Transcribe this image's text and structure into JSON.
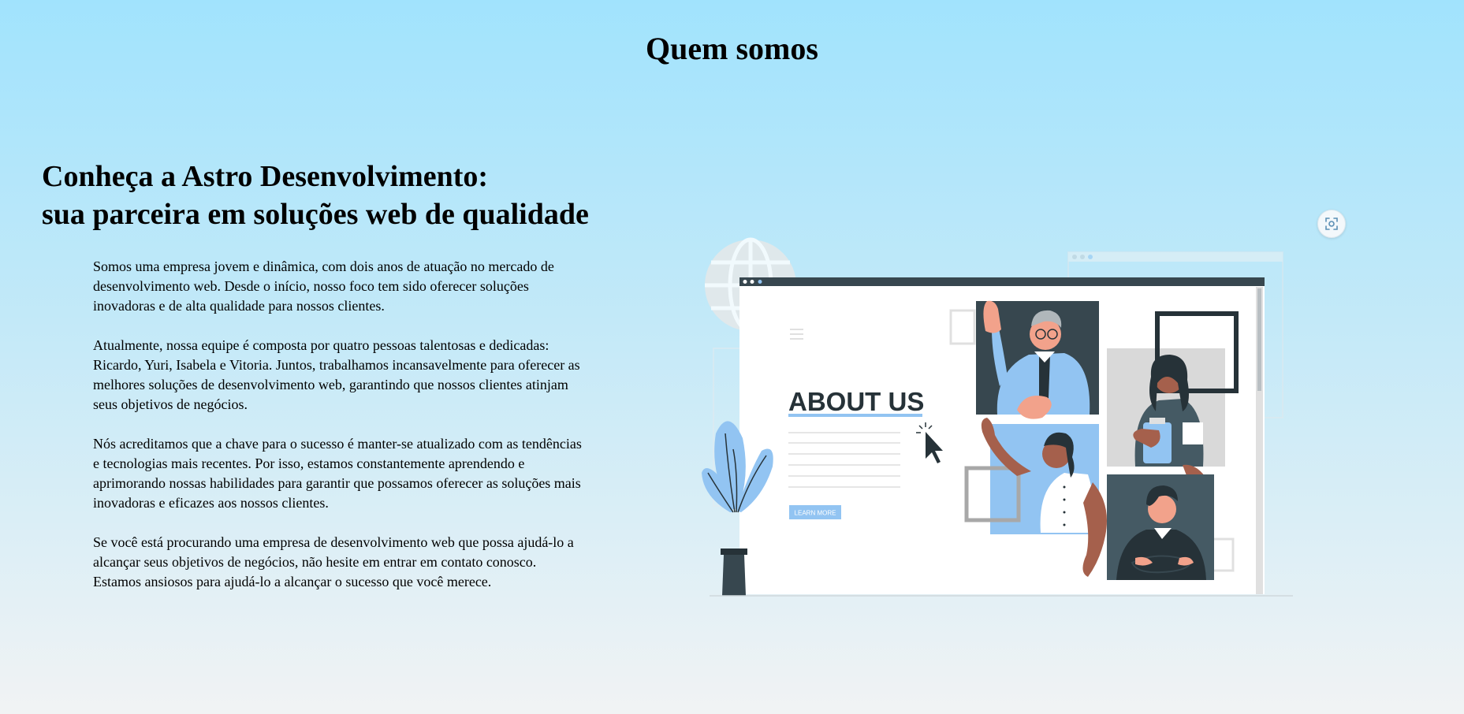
{
  "page": {
    "title": "Quem somos"
  },
  "about": {
    "heading_line1": "Conheça a Astro Desenvolvimento:",
    "heading_line2": "sua parceira em soluções web de qualidade",
    "paragraphs": [
      "Somos uma empresa jovem e dinâmica, com dois anos de atuação no mercado de desenvolvimento web. Desde o início, nosso foco tem sido oferecer soluções inovadoras e de alta qualidade para nossos clientes.",
      "Atualmente, nossa equipe é composta por quatro pessoas talentosas e dedicadas: Ricardo, Yuri, Isabela e Vitoria. Juntos, trabalhamos incansavelmente para oferecer as melhores soluções de desenvolvimento web, garantindo que nossos clientes atinjam seus objetivos de negócios.",
      "Nós acreditamos que a chave para o sucesso é manter-se atualizado com as tendências e tecnologias mais recentes. Por isso, estamos constantemente aprendendo e aprimorando nossas habilidades para garantir que possamos oferecer as soluções mais inovadoras e eficazes aos nossos clientes.",
      "Se você está procurando uma empresa de desenvolvimento web que possa ajudá-lo a alcançar seus objetivos de negócios, não hesite em entrar em contato conosco. Estamos ansiosos para ajudá-lo a alcançar o sucesso que você merece."
    ]
  },
  "illustration": {
    "headline": "ABOUT US",
    "button_label": "LEARN MORE"
  },
  "controls": {
    "expand_icon": "focus-frame-icon"
  },
  "colors": {
    "accent_blue": "#92c4f2",
    "dark_slate": "#37474f",
    "skin_dark": "#a5604c",
    "skin_light": "#f2a28b"
  }
}
